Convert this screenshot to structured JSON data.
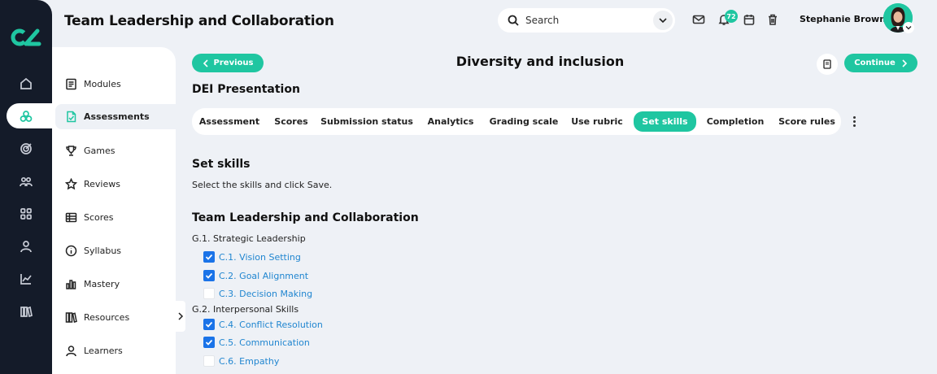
{
  "header": {
    "title": "Team Leadership and Collaboration",
    "search_placeholder": "Search",
    "notification_count": "72",
    "user_name": "Stephanie Brown"
  },
  "rail": {
    "icons": [
      "home-icon",
      "assessments-icon",
      "target-icon",
      "people-icon",
      "apps-icon",
      "user-icon",
      "chart-icon",
      "library-icon"
    ],
    "active": "assessments-icon"
  },
  "sidebar": {
    "items": [
      {
        "label": "Modules",
        "icon": "modules-icon"
      },
      {
        "label": "Assessments",
        "icon": "assessment-doc-icon"
      },
      {
        "label": "Games",
        "icon": "trophy-icon"
      },
      {
        "label": "Reviews",
        "icon": "star-icon"
      },
      {
        "label": "Scores",
        "icon": "table-icon"
      },
      {
        "label": "Syllabus",
        "icon": "info-icon"
      },
      {
        "label": "Mastery",
        "icon": "bar-chart-icon"
      },
      {
        "label": "Resources",
        "icon": "books-icon"
      },
      {
        "label": "Learners",
        "icon": "learner-icon"
      }
    ],
    "active": "Assessments"
  },
  "main": {
    "previous_label": "Previous",
    "continue_label": "Continue",
    "page_title": "Diversity and inclusion",
    "presentation_title": "DEI Presentation",
    "tabs": [
      "Assessment",
      "Scores",
      "Submission status",
      "Analytics",
      "Grading scale",
      "Use rubric",
      "Set skills",
      "Completion",
      "Score rules"
    ],
    "active_tab": "Set skills",
    "section_title": "Set skills",
    "section_subtitle": "Select the skills and click Save.",
    "skill_set_title": "Team Leadership and Collaboration",
    "groups": [
      {
        "label": "G.1. Strategic Leadership",
        "skills": [
          {
            "label": "C.1. Vision Setting",
            "checked": true
          },
          {
            "label": "C.2. Goal Alignment",
            "checked": true
          },
          {
            "label": "C.3. Decision Making",
            "checked": false
          }
        ]
      },
      {
        "label": "G.2. Interpersonal Skills",
        "skills": [
          {
            "label": "C.4. Conflict Resolution",
            "checked": true
          },
          {
            "label": "C.5. Communication",
            "checked": true
          },
          {
            "label": "C.6. Empathy",
            "checked": false
          }
        ]
      }
    ]
  },
  "colors": {
    "accent": "#1fc6a1",
    "rail_bg": "#141b29",
    "page_bg": "#eef1f6",
    "link": "#2186d0",
    "checkbox": "#1a73e8"
  }
}
